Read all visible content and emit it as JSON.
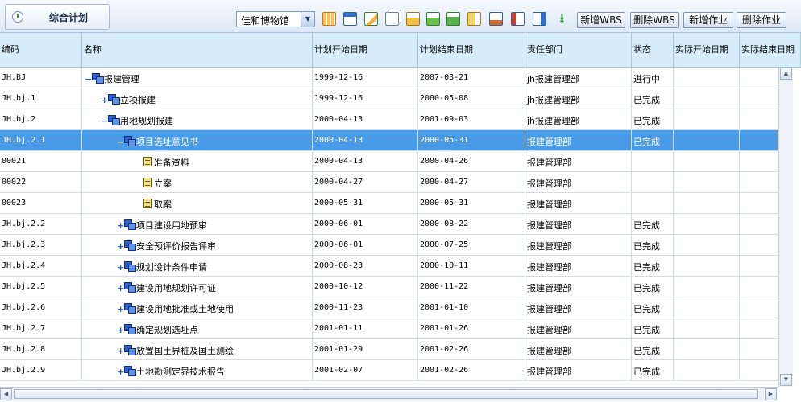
{
  "tab": {
    "title": "综合计划",
    "icon": "clock-icon"
  },
  "project_select": {
    "value": "佳和博物馆"
  },
  "toolbar": {
    "icons": [
      "grid-view-icon",
      "form-view-icon",
      "edit-icon",
      "copy-icon",
      "import-icon",
      "export-icon",
      "excel-icon",
      "move-icon",
      "check-icon",
      "indent-icon",
      "outdent-icon",
      "download-icon"
    ],
    "buttons": [
      "新增WBS",
      "删除WBS",
      "新增作业",
      "删除作业"
    ]
  },
  "colors": {
    "header_bg": "#d7ecf9",
    "selected_row": "#4a9be6",
    "toggle": "#2f5fa8"
  },
  "columns": [
    "编码",
    "名称",
    "计划开始日期",
    "计划结束日期",
    "责任部门",
    "状态",
    "实际开始日期",
    "实际结束日期"
  ],
  "rows": [
    {
      "code": "JH.BJ",
      "name": "报建管理",
      "level": 0,
      "toggle": "−",
      "type": "wbs",
      "plan_start": "1999-12-16",
      "plan_end": "2007-03-21",
      "dept": "jh报建管理部",
      "status": "进行中"
    },
    {
      "code": "JH.bj.1",
      "name": "立项报建",
      "level": 1,
      "toggle": "+",
      "type": "wbs",
      "plan_start": "1999-12-16",
      "plan_end": "2000-05-08",
      "dept": "jh报建管理部",
      "status": "已完成"
    },
    {
      "code": "JH.bj.2",
      "name": "用地规划报建",
      "level": 1,
      "toggle": "−",
      "type": "wbs",
      "plan_start": "2000-04-13",
      "plan_end": "2001-09-03",
      "dept": "jh报建管理部",
      "status": "已完成"
    },
    {
      "code": "JH.bj.2.1",
      "name": "项目选址意见书",
      "level": 2,
      "toggle": "−",
      "type": "wbs",
      "plan_start": "2000-04-13",
      "plan_end": "2000-05-31",
      "dept": "报建管理部",
      "status": "已完成",
      "selected": true
    },
    {
      "code": "00021",
      "name": "准备资料",
      "level": 3,
      "toggle": "",
      "type": "task",
      "plan_start": "2000-04-13",
      "plan_end": "2000-04-26",
      "dept": "报建管理部",
      "status": ""
    },
    {
      "code": "00022",
      "name": "立案",
      "level": 3,
      "toggle": "",
      "type": "task",
      "plan_start": "2000-04-27",
      "plan_end": "2000-04-27",
      "dept": "报建管理部",
      "status": ""
    },
    {
      "code": "00023",
      "name": "取案",
      "level": 3,
      "toggle": "",
      "type": "task",
      "plan_start": "2000-05-31",
      "plan_end": "2000-05-31",
      "dept": "报建管理部",
      "status": ""
    },
    {
      "code": "JH.bj.2.2",
      "name": "项目建设用地预审",
      "level": 2,
      "toggle": "+",
      "type": "wbs",
      "plan_start": "2000-06-01",
      "plan_end": "2000-08-22",
      "dept": "报建管理部",
      "status": "已完成"
    },
    {
      "code": "JH.bj.2.3",
      "name": "安全预评价报告评审",
      "level": 2,
      "toggle": "+",
      "type": "wbs",
      "plan_start": "2000-06-01",
      "plan_end": "2000-07-25",
      "dept": "报建管理部",
      "status": "已完成"
    },
    {
      "code": "JH.bj.2.4",
      "name": "规划设计条件申请",
      "level": 2,
      "toggle": "+",
      "type": "wbs",
      "plan_start": "2000-08-23",
      "plan_end": "2000-10-11",
      "dept": "报建管理部",
      "status": "已完成"
    },
    {
      "code": "JH.bj.2.5",
      "name": "建设用地规划许可证",
      "level": 2,
      "toggle": "+",
      "type": "wbs",
      "plan_start": "2000-10-12",
      "plan_end": "2000-11-22",
      "dept": "报建管理部",
      "status": "已完成"
    },
    {
      "code": "JH.bj.2.6",
      "name": "建设用地批准或土地使用",
      "level": 2,
      "toggle": "+",
      "type": "wbs",
      "plan_start": "2000-11-23",
      "plan_end": "2001-01-10",
      "dept": "报建管理部",
      "status": "已完成"
    },
    {
      "code": "JH.bj.2.7",
      "name": "确定规划选址点",
      "level": 2,
      "toggle": "+",
      "type": "wbs",
      "plan_start": "2001-01-11",
      "plan_end": "2001-01-26",
      "dept": "报建管理部",
      "status": "已完成"
    },
    {
      "code": "JH.bj.2.8",
      "name": "放置国土界桩及国土测绘",
      "level": 2,
      "toggle": "+",
      "type": "wbs",
      "plan_start": "2001-01-29",
      "plan_end": "2001-02-26",
      "dept": "报建管理部",
      "status": "已完成"
    },
    {
      "code": "JH.bj.2.9",
      "name": "土地勘测定界技术报告",
      "level": 2,
      "toggle": "+",
      "type": "wbs",
      "plan_start": "2001-02-07",
      "plan_end": "2001-02-26",
      "dept": "报建管理部",
      "status": "已完成"
    }
  ]
}
